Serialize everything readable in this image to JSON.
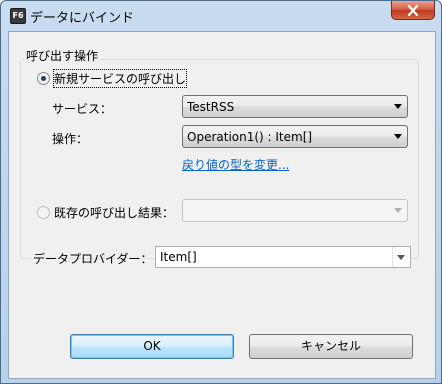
{
  "window": {
    "app_icon_text": "F6",
    "title": "データにバインド"
  },
  "group": {
    "legend": "呼び出す操作",
    "new_call": {
      "label": "新規サービスの呼び出し",
      "selected": true,
      "service_label": "サービス：",
      "service_value": "TestRSS",
      "operation_label": "操作：",
      "operation_value": "Operation1() : Item[]",
      "change_return_type_link": "戻り値の型を変更..."
    },
    "existing_call": {
      "label": "既存の呼び出し結果：",
      "selected": false,
      "value": ""
    }
  },
  "data_provider": {
    "label": "データプロバイダー：",
    "value": "Item[]"
  },
  "buttons": {
    "ok": "OK",
    "cancel": "キャンセル"
  },
  "colors": {
    "link": "#0066cc",
    "close_button": "#c8412a",
    "title_bar": "#c9dcf0"
  }
}
